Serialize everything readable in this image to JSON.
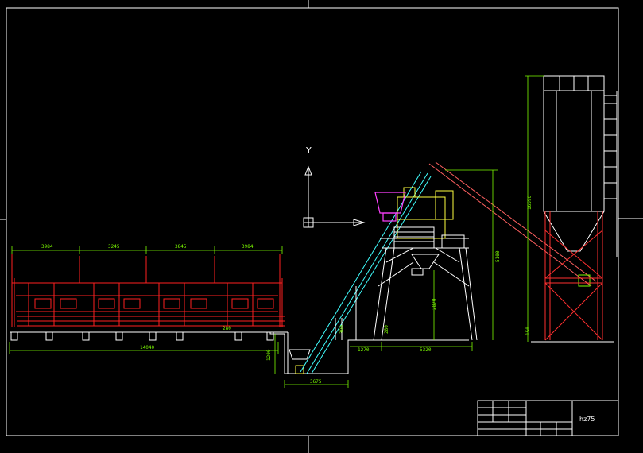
{
  "drawing": {
    "ucs_axis_label": "Y",
    "title_block": {
      "drawing_name": "hz75"
    }
  },
  "dimensions": {
    "bins": [
      "3984",
      "3245",
      "3845",
      "3984"
    ],
    "bin_total": "14040",
    "pit_depth": "1200",
    "pit_width": "3675",
    "belt_offset": "1270",
    "base_span": "5320",
    "mixer_height": "5100",
    "discharge_height": "2870",
    "silo_height": "16590",
    "small_a": "280",
    "small_b": "380",
    "small_c": "280",
    "small_d": "150"
  },
  "colors": {
    "background": "#000000",
    "batcher": "#ff2020",
    "dimension": "#7CFC00",
    "frame": "#ffffff",
    "mixer": "#ffff40",
    "hopper": "#ff40ff",
    "conveyor": "#40ffff",
    "silo_brace": "#ff3030"
  }
}
